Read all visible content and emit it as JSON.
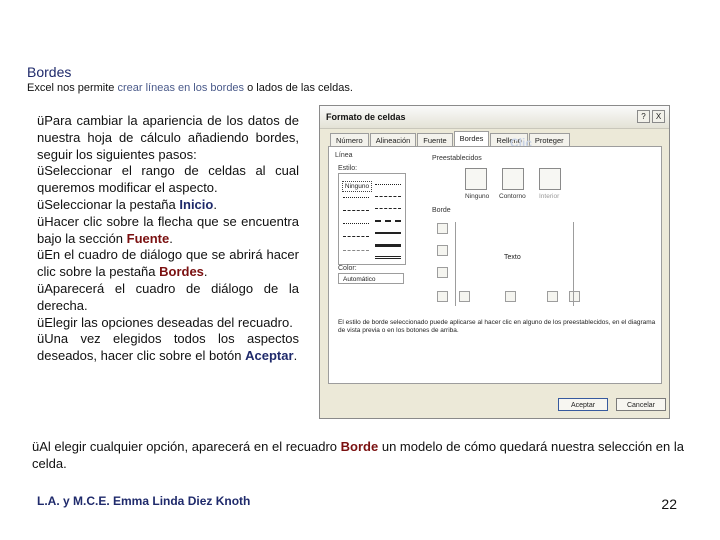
{
  "slide": {
    "title": "Bordes",
    "subtitle_pre": "Excel nos permite ",
    "subtitle_hl": "crear líneas en los bordes",
    "subtitle_post": " o lados de las celdas.",
    "check": "ü",
    "step1": "Para cambiar la apariencia de los datos de nuestra hoja de cálculo añadiendo bordes, seguir los siguientes pasos:",
    "step2": "Seleccionar el rango de celdas al cual queremos modificar el aspecto.",
    "step3_pre": "Seleccionar la pestaña ",
    "step3_bold": "Inicio",
    "step3_post": ".",
    "step4_pre": "Hacer clic sobre la flecha que se encuentra bajo la sección ",
    "step4_bold": "Fuente",
    "step4_post": ".",
    "step5_pre": "En el cuadro de diálogo que se abrirá hacer clic sobre la pestaña ",
    "step5_bold": "Bordes",
    "step5_post": ".",
    "step6": "Aparecerá el cuadro de diálogo de la derecha.",
    "step7": "Elegir las opciones deseadas del recuadro.",
    "step8_pre": "Una vez elegidos todos los aspectos deseados, hacer clic sobre el botón ",
    "step8_bold": "Aceptar",
    "step8_post": ".",
    "note_pre": "Al elegir cualquier opción, aparecerá en el recuadro ",
    "note_bold": "Borde",
    "note_post": " un modelo de cómo quedará nuestra selección en la celda.",
    "footer": "L.A. y M.C.E. Emma Linda Diez Knoth",
    "page_number": "22"
  },
  "dialog": {
    "title": "Formato de celdas",
    "help": "?",
    "close": "X",
    "tabs": [
      "Número",
      "Alineación",
      "Fuente",
      "Bordes",
      "Relleno",
      "Proteger"
    ],
    "active_tab": "Bordes",
    "line_group": "Línea",
    "style_label": "Estilo:",
    "style_none": "Ninguno",
    "color_label": "Color:",
    "color_value": "Automático",
    "presets_label": "Preestablecidos",
    "preset_none": "Ninguno",
    "preset_outline": "Contorno",
    "preset_inside": "Interior",
    "border_label": "Borde",
    "preview_text": "Texto",
    "info_text": "El estilo de borde seleccionado puede aplicarse al hacer clic en alguno de los preestablecidos, en el diagrama de vista previa o en los botones de arriba.",
    "ok": "Aceptar",
    "cancel": "Cancelar",
    "watermark": "Clic"
  }
}
